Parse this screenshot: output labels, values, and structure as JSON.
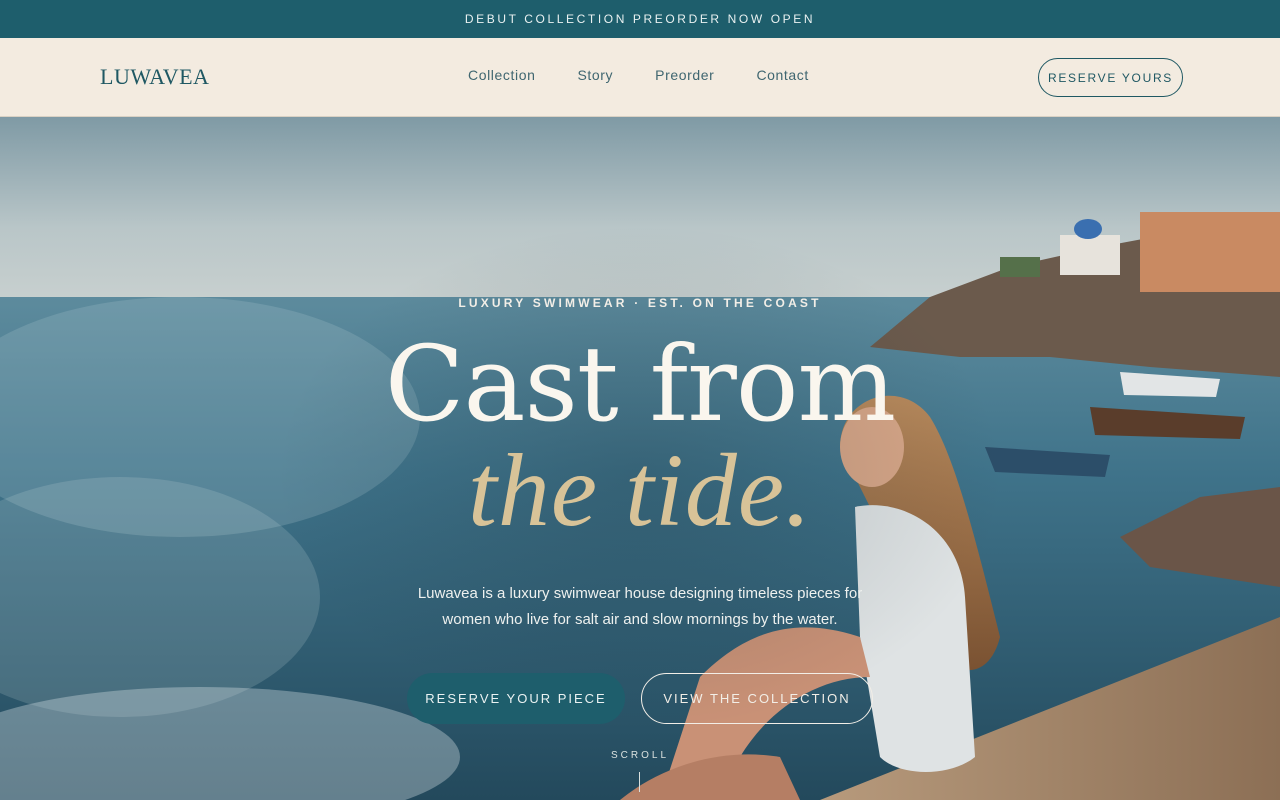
{
  "announcement": {
    "text": "DEBUT COLLECTION PREORDER NOW OPEN"
  },
  "header": {
    "logo": "LUWAVEA",
    "nav": [
      {
        "label": "Collection"
      },
      {
        "label": "Story"
      },
      {
        "label": "Preorder"
      },
      {
        "label": "Contact"
      }
    ],
    "cta": "RESERVE YOURS"
  },
  "hero": {
    "eyebrow": "LUXURY SWIMWEAR · EST. ON THE COAST",
    "title_line1": "Cast from",
    "title_line2": "the tide.",
    "subtitle": "Luwavea is a luxury swimwear house designing timeless pieces for women who live for salt air and slow mornings by the water.",
    "primary_button": "RESERVE YOUR PIECE",
    "secondary_button": "VIEW THE COLLECTION",
    "scroll_label": "SCROLL"
  },
  "colors": {
    "brand_teal": "#1e5e6c",
    "cream": "#f3ebe0",
    "gold_accent": "#d8c398"
  }
}
